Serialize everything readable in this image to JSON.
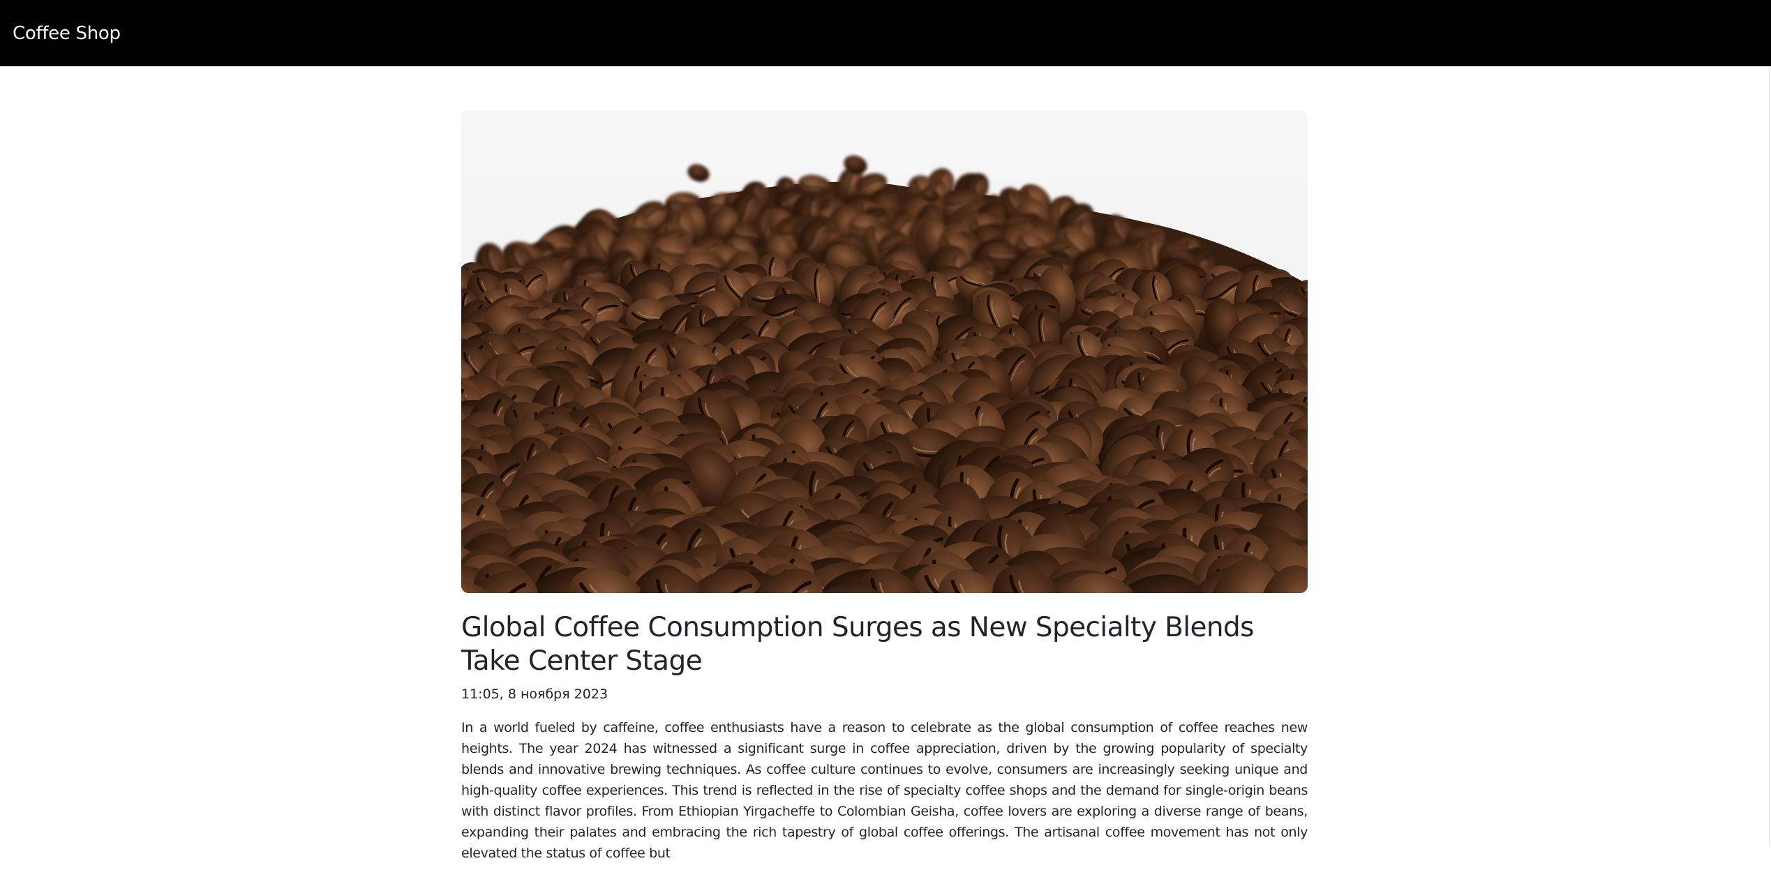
{
  "navbar": {
    "brand": "Coffee Shop"
  },
  "article": {
    "image_subject": "coffee beans",
    "title": "Global Coffee Consumption Surges as New Specialty Blends Take Center Stage",
    "date": "11:05, 8 ноября 2023",
    "body": "In a world fueled by caffeine, coffee enthusiasts have a reason to celebrate as the global consumption of coffee reaches new heights. The year 2024 has witnessed a significant surge in coffee appreciation, driven by the growing popularity of specialty blends and innovative brewing techniques. As coffee culture continues to evolve, consumers are increasingly seeking unique and high-quality coffee experiences. This trend is reflected in the rise of specialty coffee shops and the demand for single-origin beans with distinct flavor profiles. From Ethiopian Yirgacheffe to Colombian Geisha, coffee lovers are exploring a diverse range of beans, expanding their palates and embracing the rich tapestry of global coffee offerings. The artisanal coffee movement has not only elevated the status of coffee but"
  },
  "colors": {
    "navbar_bg": "#000000",
    "brand_text": "#ffffff",
    "text": "#212529"
  }
}
